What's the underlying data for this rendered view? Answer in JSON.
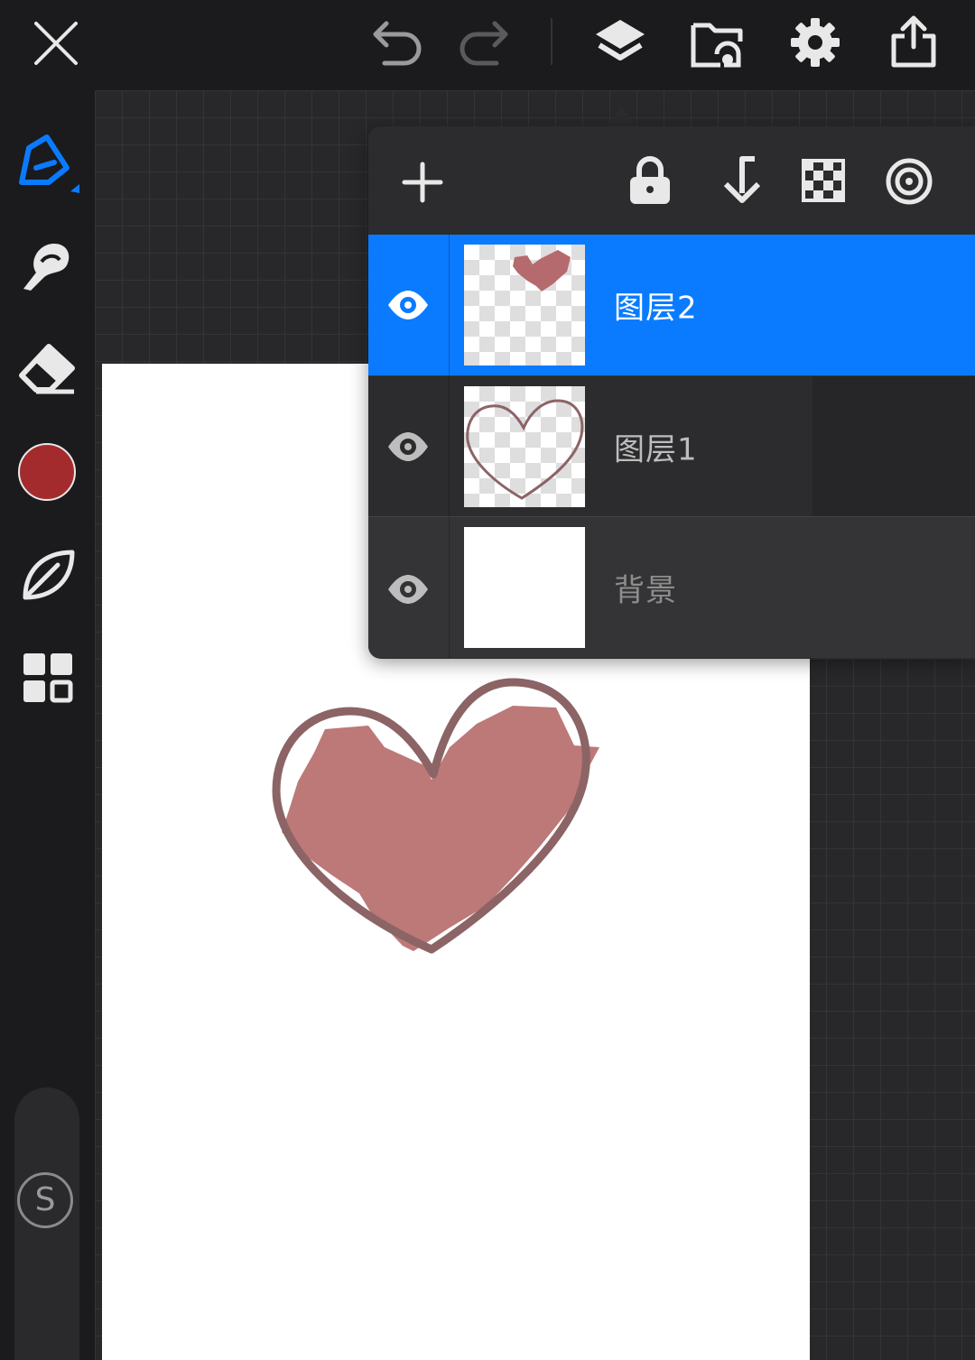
{
  "toolbar": {
    "icons": [
      "close-icon",
      "undo-icon",
      "redo-icon",
      "layers-icon",
      "gallery-icon",
      "settings-icon",
      "share-icon"
    ]
  },
  "sidebar": {
    "icons": [
      "brush-icon",
      "smudge-icon",
      "eraser-icon",
      "color-swatch",
      "leaf-icon",
      "grid-icon"
    ],
    "brush_color": "#a32b2e",
    "s_label": "S"
  },
  "layers_panel": {
    "header_icons": [
      "add-layer-icon",
      "lock-icon",
      "merge-down-icon",
      "checkerboard-icon",
      "target-icon"
    ],
    "layers": [
      {
        "name": "图层2",
        "visible": true,
        "selected": true
      },
      {
        "name": "图层1",
        "visible": true,
        "selected": false
      },
      {
        "name": "背景",
        "visible": true,
        "selected": false
      }
    ]
  },
  "colors": {
    "accent": "#0a7bff",
    "heart_fill": "#bd7878",
    "heart_outline": "#8c6466"
  }
}
